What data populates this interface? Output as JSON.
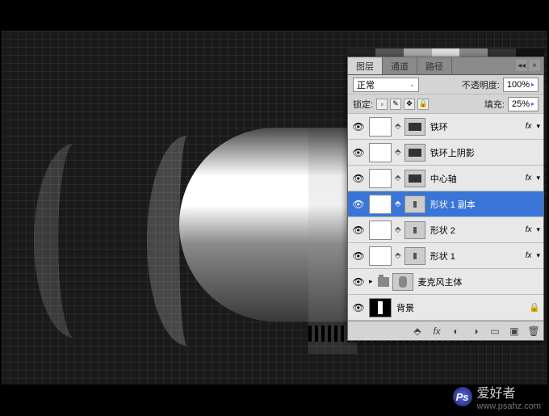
{
  "tabs": {
    "layers": "图层",
    "channels": "通道",
    "paths": "路径"
  },
  "blend": {
    "mode": "正常",
    "opacity_label": "不透明度:",
    "opacity_value": "100%"
  },
  "lock": {
    "label": "锁定:",
    "fill_label": "填充:",
    "fill_value": "25%"
  },
  "layers_list": [
    {
      "name": "铁环",
      "fx": true,
      "selected": false,
      "mask": "bar"
    },
    {
      "name": "铁环上阴影",
      "fx": false,
      "selected": false,
      "mask": "bar"
    },
    {
      "name": "中心轴",
      "fx": true,
      "selected": false,
      "mask": "bar"
    },
    {
      "name": "形状 1 副本",
      "fx": false,
      "selected": true,
      "mask": "dot"
    },
    {
      "name": "形状 2",
      "fx": true,
      "selected": false,
      "mask": "dot"
    },
    {
      "name": "形状 1",
      "fx": true,
      "selected": false,
      "mask": "dot"
    }
  ],
  "group": {
    "name": "麦克风主体"
  },
  "bg": {
    "name": "背景"
  },
  "watermark": {
    "logo": "Ps",
    "title": "爱好者",
    "url": "www.psahz.com"
  }
}
